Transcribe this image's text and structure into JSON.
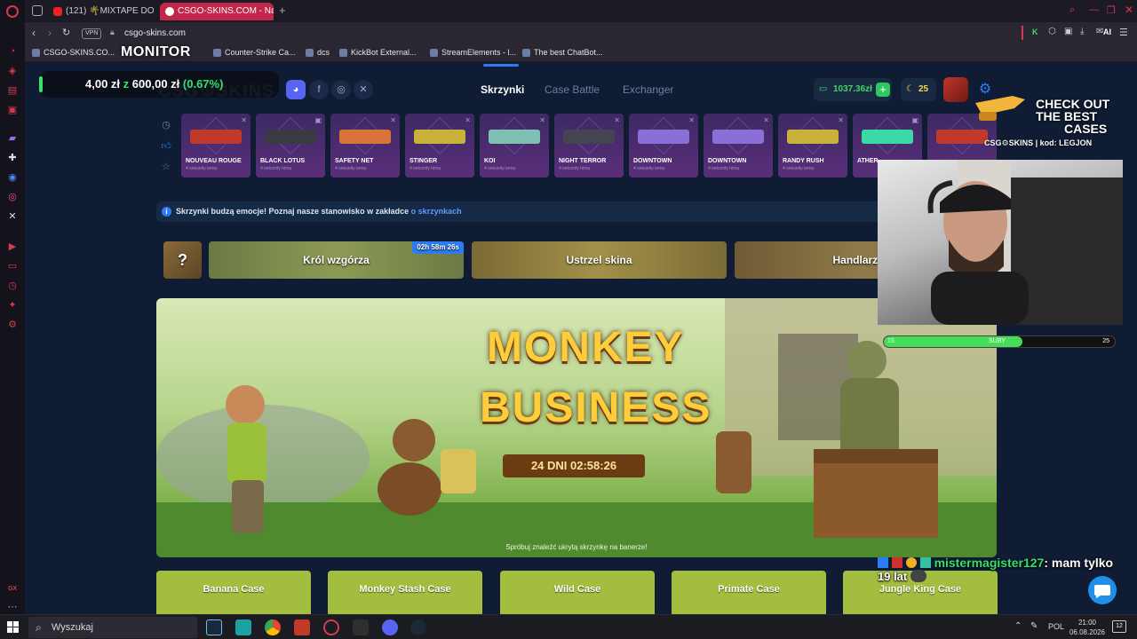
{
  "browser": {
    "tabs": [
      {
        "label": "(121) 🌴MIXTAPE DO",
        "active": false
      },
      {
        "label": "CSGO-SKINS.COM - Najle",
        "active": true
      }
    ],
    "new_tab": "+",
    "url": "csgo-skins.com",
    "vpn": "VPN",
    "ai_label": "AI",
    "bookmarks": [
      "CSGO-SKINS.CO...",
      "Counter-Strike Ca...",
      "dcs",
      "KickBot External...",
      "StreamElements - l...",
      "The best ChatBot..."
    ]
  },
  "site": {
    "logo": "CSG⚙SKINS",
    "nav": [
      {
        "label": "Skrzynki",
        "active": true
      },
      {
        "label": "Case Battle",
        "active": false
      },
      {
        "label": "Exchanger",
        "active": false
      }
    ],
    "balance": "1037.36zł",
    "plus": "+",
    "coins": "25",
    "drops": [
      {
        "name": "NOUVEAU ROUGE",
        "sub": "4 sekundy temu",
        "color": "#c0392b"
      },
      {
        "name": "BLACK LOTUS",
        "sub": "4 sekundy temu",
        "color": "#3a3a44"
      },
      {
        "name": "SAFETY NET",
        "sub": "4 sekundy temu",
        "color": "#d9733a"
      },
      {
        "name": "STINGER",
        "sub": "4 sekundy temu",
        "color": "#c8b23a"
      },
      {
        "name": "KOI",
        "sub": "4 sekundy temu",
        "color": "#7fc0b5"
      },
      {
        "name": "NIGHT TERROR",
        "sub": "4 sekundy temu",
        "color": "#454552"
      },
      {
        "name": "DOWNTOWN",
        "sub": "4 sekundy temu",
        "color": "#8a6fd8"
      },
      {
        "name": "DOWNTOWN",
        "sub": "4 sekundy temu",
        "color": "#8a6fd8"
      },
      {
        "name": "RANDY RUSH",
        "sub": "4 sekundy temu",
        "color": "#c8b23a"
      },
      {
        "name": "ATHER",
        "sub": "",
        "color": "#3ad9a8"
      }
    ],
    "notice": {
      "text": "Skrzynki budzą emocje! Poznaj nasze stanowisko w zakładce ",
      "link": "o skrzynkach"
    },
    "events": [
      {
        "label": "?",
        "timer": ""
      },
      {
        "label": "Król wzgórza",
        "timer": "02h 58m 26s"
      },
      {
        "label": "Ustrzel skina",
        "timer": ""
      },
      {
        "label": "Handlarz br",
        "timer": ""
      }
    ],
    "banner": {
      "title_line1": "MONKEY",
      "title_line2": "BUSINESS",
      "countdown": "24 DNI  02:58:26",
      "footer": "Spróbuj znaleźć ukrytą skrzynkę na banerze!"
    },
    "cases": [
      "Banana Case",
      "Monkey Stash Case",
      "Wild Case",
      "Primate Case",
      "Jungle King Case"
    ]
  },
  "overlay": {
    "ticker_left": "4,00 zł",
    "ticker_mid": "z",
    "ticker_right": "600,00 zł",
    "ticker_pct": "(0.67%)",
    "monitor": "MONITOR",
    "promo_line1": "CHECK OUT",
    "promo_line2": "THE BEST",
    "promo_line3": "CASES",
    "promo_brand": "CSG⚙SKINS | kod: LEGJON",
    "subbar": {
      "left": "15",
      "label": "SUBY",
      "right": "25",
      "progress": 0.6
    },
    "chat_user": "mistermagister127",
    "chat_msg": ": mam tylko",
    "chat_msg2": "19 lat"
  },
  "taskbar": {
    "search_placeholder": "Wyszukaj",
    "lang": "POL",
    "time": "21:00",
    "date": "06.08.2026",
    "notif": "12"
  }
}
